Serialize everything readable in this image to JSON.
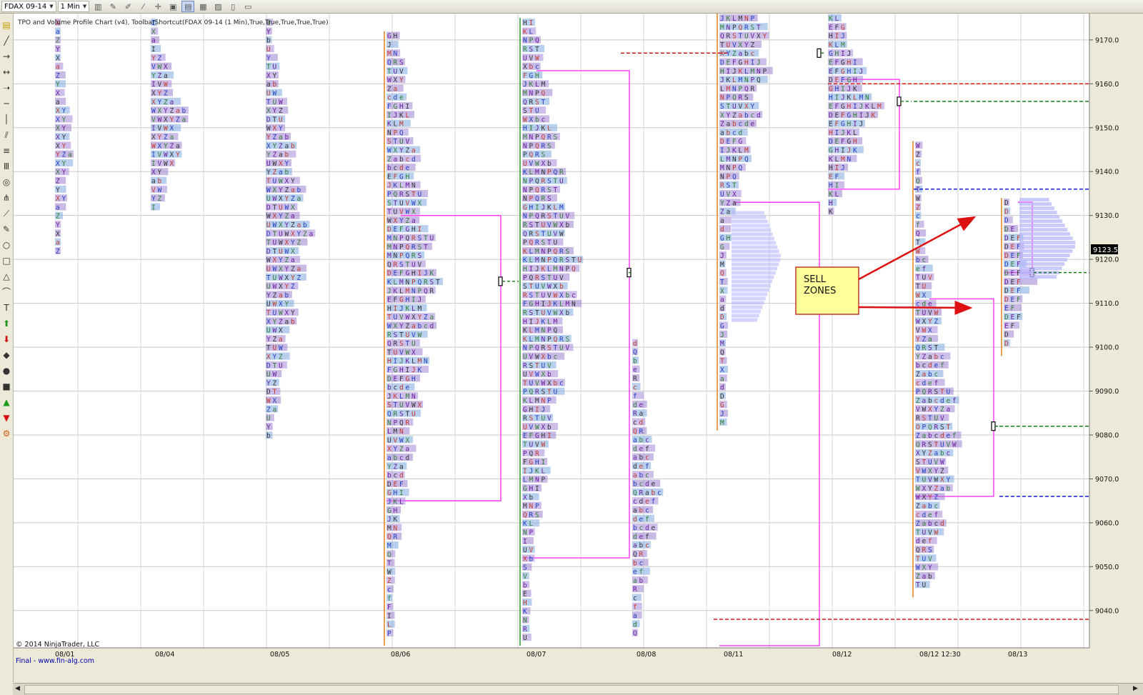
{
  "toolbar": {
    "instrument": "FDAX 09-14",
    "interval": "1 Min",
    "icons": [
      "bar-chart-icon",
      "pencil-icon",
      "brush-icon",
      "wand-icon",
      "crosshair-icon",
      "zoom-icon",
      "tpo-chart-icon",
      "bar-type-icon",
      "image-icon",
      "data-box-icon",
      "panel-icon"
    ]
  },
  "left_tools": [
    "chart-trader-icon",
    "line-icon",
    "ray-icon",
    "extended-line-icon",
    "arrow-line-icon",
    "horizontal-line-icon",
    "vertical-line-icon",
    "channel-icon",
    "fibonacci-icon",
    "fib-time-icon",
    "gann-icon",
    "pitchfork-icon",
    "regression-icon",
    "pen-icon",
    "ellipse-icon",
    "rectangle-icon",
    "triangle-icon",
    "arc-icon",
    "text-icon",
    "arrow-up-icon",
    "arrow-down-icon",
    "diamond-icon",
    "dot-icon",
    "square-icon",
    "triangle-up-icon",
    "triangle-down-icon",
    "settings-icon"
  ],
  "chart_header": "TPO and Volume Profile Chart (v4), ToolbarShortcut(FDAX 09-14 (1 Min),True,True,True,True,True)",
  "copyright": "© 2014 NinjaTrader, LLC",
  "watermark": "Final - www.fin-alg.com",
  "annotation": {
    "line1": "SELL",
    "line2": "ZONES"
  },
  "colors": {
    "value_area": "#ff33ff",
    "poc": "#007700",
    "vah": "#cc0000",
    "val": "#0000cc",
    "hvn": "#b8b8ff",
    "callout": "#ffff99",
    "arrow": "#dd1111",
    "last_price": "#000000"
  },
  "chart_data": {
    "type": "tpo_market_profile",
    "title": "",
    "xlabel": "",
    "ylabel": "",
    "y_ticks": [
      9170.0,
      9160.0,
      9150.0,
      9140.0,
      9130.0,
      9120.0,
      9110.0,
      9100.0,
      9090.0,
      9080.0,
      9070.0,
      9060.0,
      9050.0,
      9040.0
    ],
    "ylim": [
      9031.5,
      9176.0
    ],
    "last_price": "9123.5",
    "sessions": [
      {
        "label": "08/01",
        "top": 9175,
        "bottom": 9120,
        "letters": "XYZa"
      },
      {
        "label": "08/04",
        "top": 9175,
        "bottom": 9129,
        "letters": "HIVWXYZab"
      },
      {
        "label": "08/05",
        "top": 9175,
        "bottom": 9078,
        "letters": "DTUWXYZab"
      },
      {
        "label": "08/06",
        "top": 9172,
        "bottom": 9032,
        "letters": "DEFGHIJKLMNPQRSTUVWXYZabcdef",
        "poc": 9115,
        "va_high": 9130,
        "va_low": 9065
      },
      {
        "label": "08/07",
        "top": 9175,
        "bottom": 9032,
        "letters": "DEFGHIJKLMNPQRSTUVWXbc",
        "poc": 9117,
        "va_high": 9163,
        "va_low": 9052
      },
      {
        "label": "08/08",
        "top": 9102,
        "bottom": 9032,
        "letters": "QRabcdef",
        "va_high": 9039
      },
      {
        "label": "08/11",
        "top": 9176,
        "bottom": 9081,
        "letters": "DEFGHIJKLMNPQRSTUVXYZabcdef",
        "poc": 9167,
        "va_high": 9133,
        "va_low": 9032,
        "vah_line": 9164,
        "val_line": 9038
      },
      {
        "label": "08/12",
        "top": 9176,
        "bottom": 9128,
        "letters": "DEFGHIJKLMN",
        "poc": 9156,
        "va_high": 9161,
        "va_low": 9136
      },
      {
        "label": "08/12 12:30",
        "top": 9147,
        "bottom": 9043,
        "letters": "OPQRSTUVWXYZabcdef",
        "poc": 9082,
        "va_high": 9111,
        "va_low": 9066
      },
      {
        "label": "08/13",
        "top": 9134,
        "bottom": 9098,
        "letters": "DEF",
        "poc": 9117,
        "va_high": 9133,
        "va_low": 9117
      }
    ]
  }
}
